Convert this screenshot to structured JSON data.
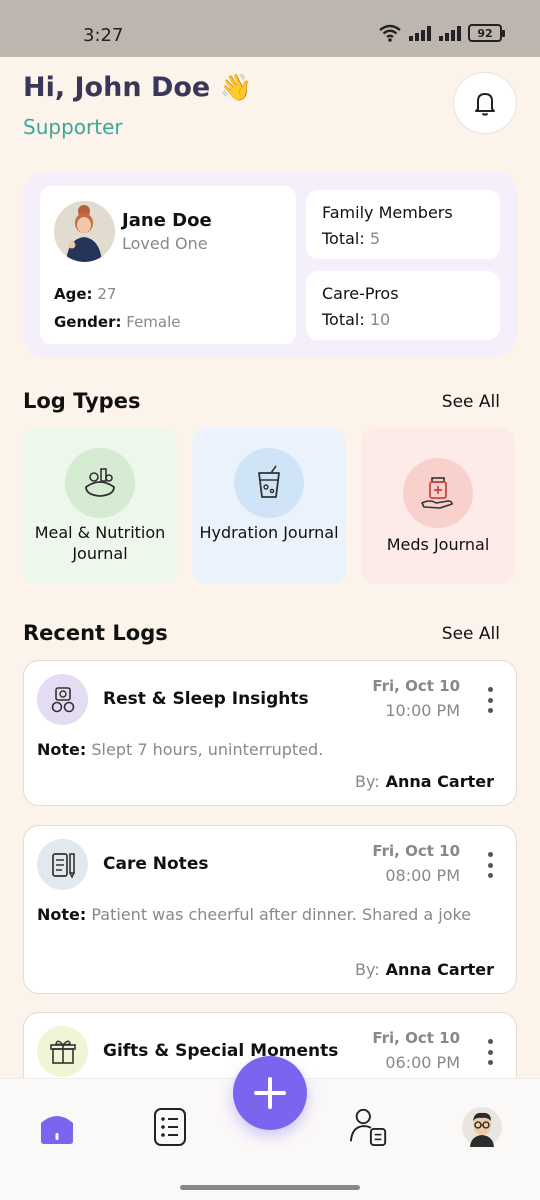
{
  "status_bar": {
    "time": "3:27",
    "battery": "92"
  },
  "header": {
    "greeting": "Hi, John Doe",
    "emoji": "👋",
    "role": "Supporter"
  },
  "loved_one": {
    "name": "Jane Doe",
    "relation": "Loved One",
    "age_label": "Age:",
    "age": "27",
    "gender_label": "Gender:",
    "gender": "Female"
  },
  "stats": [
    {
      "title": "Family Members",
      "total_label": "Total:",
      "total": "5"
    },
    {
      "title": "Care-Pros",
      "total_label": "Total:",
      "total": "10"
    }
  ],
  "log_types": {
    "title": "Log Types",
    "see_all": "See All",
    "items": [
      {
        "label": "Meal & Nutrition Journal",
        "icon": "meal-icon",
        "bg": "#eef7ec",
        "icon_bg": "#d5ecd2"
      },
      {
        "label": "Hydration Journal",
        "icon": "hydration-icon",
        "bg": "#eaf3fb",
        "icon_bg": "#cfe5f7"
      },
      {
        "label": "Meds Journal",
        "icon": "meds-icon",
        "bg": "#fcebe8",
        "icon_bg": "#f8d1cc"
      }
    ]
  },
  "recent_logs": {
    "title": "Recent Logs",
    "see_all": "See All",
    "items": [
      {
        "title": "Rest & Sleep Insights",
        "date": "Fri, Oct 10",
        "time": "10:00 PM",
        "note_label": "Note:",
        "note": "Slept 7 hours, uninterrupted.",
        "by_label": "By:",
        "by": "Anna Carter",
        "icon": "sleep-icon",
        "icon_bg": "#e3dcf3"
      },
      {
        "title": "Care Notes",
        "date": "Fri, Oct 10",
        "time": "08:00 PM",
        "note_label": "Note:",
        "note": "Patient was cheerful after dinner. Shared a joke",
        "by_label": "By:",
        "by": "Anna Carter",
        "icon": "notes-icon",
        "icon_bg": "#e3e8ec"
      },
      {
        "title": "Gifts & Special Moments",
        "date": "Fri, Oct 10",
        "time": "06:00 PM",
        "icon": "gift-icon",
        "icon_bg": "#f0f5d6"
      }
    ]
  },
  "nav": {
    "items": [
      "home",
      "logs",
      "add",
      "care-team",
      "profile"
    ],
    "accent": "#7a66ee"
  }
}
